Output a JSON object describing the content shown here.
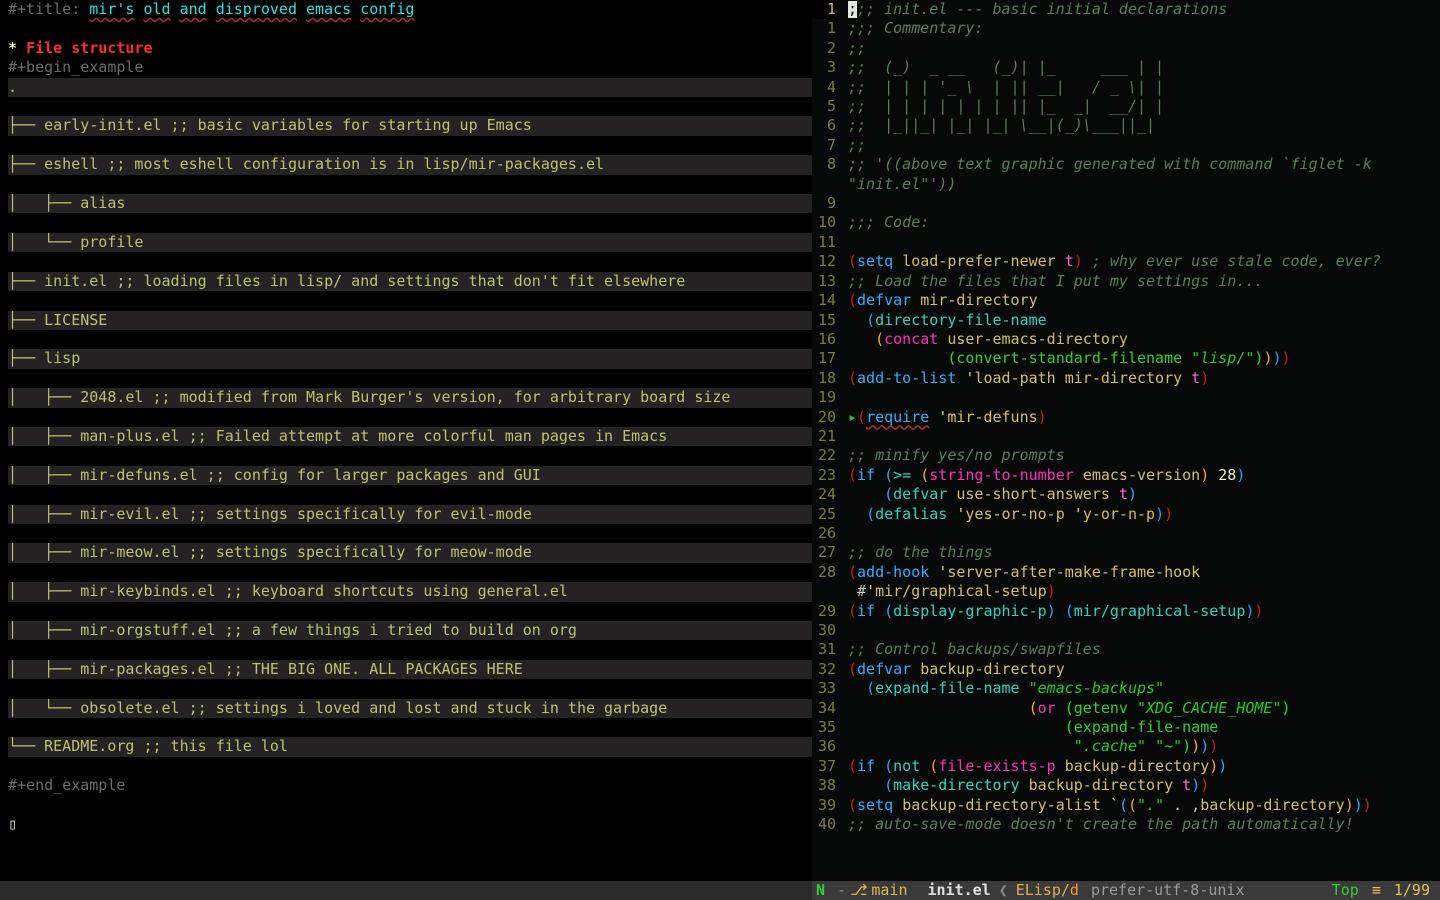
{
  "left": {
    "title_prefix": "#+title: ",
    "title_words": [
      "mir's",
      "old",
      "and",
      "disproved",
      "emacs",
      "config"
    ],
    "heading_star": "* ",
    "heading": "File structure",
    "begin": "#+begin_example",
    "end": "#+end_example",
    "tree": [
      ".",
      "├── early-init.el ;; basic variables for starting up Emacs",
      "├── eshell ;; most eshell configuration is in lisp/mir-packages.el",
      "│   ├── alias",
      "│   └── profile",
      "├── init.el ;; loading files in lisp/ and settings that don't fit elsewhere",
      "├── LICENSE",
      "├── lisp",
      "│   ├── 2048.el ;; modified from Mark Burger's version, for arbitrary board size",
      "│   ├── man-plus.el ;; Failed attempt at more colorful man pages in Emacs",
      "│   ├── mir-defuns.el ;; config for larger packages and GUI",
      "│   ├── mir-evil.el ;; settings specifically for evil-mode",
      "│   ├── mir-meow.el ;; settings specifically for meow-mode",
      "│   ├── mir-keybinds.el ;; keyboard shortcuts using general.el",
      "│   ├── mir-orgstuff.el ;; a few things i tried to build on org",
      "│   ├── mir-packages.el ;; THE BIG ONE. ALL PACKAGES HERE",
      "│   └── obsolete.el ;; settings i loved and lost and stuck in the garbage",
      "└── README.org ;; this file lol"
    ]
  },
  "right": {
    "current_line_badge": "1",
    "lines": [
      {
        "n": "",
        "raw": ";;; init.el --- basic initial declarations",
        "cls": "cmt"
      },
      {
        "n": "1",
        "raw": ";;; Commentary:",
        "cls": "cmt"
      },
      {
        "n": "2",
        "raw": ";;",
        "cls": "cmt"
      },
      {
        "n": "3",
        "raw": ";;  (_)  _ __   (_)| |_     ___ | |",
        "cls": "cmt"
      },
      {
        "n": "4",
        "raw": ";;  | | | '_ \\  | || __|   / _ \\| |",
        "cls": "cmt"
      },
      {
        "n": "5",
        "raw": ";;  | | | | | | | || |_  _|  __/| |",
        "cls": "cmt"
      },
      {
        "n": "6",
        "raw": ";;  |_||_| |_| |_| \\__|(_)\\___||_|",
        "cls": "cmt"
      },
      {
        "n": "7",
        "raw": ";;",
        "cls": "cmt"
      },
      {
        "n": "8",
        "raw": ";; '((above text graphic generated with command `figlet -k \"init.el\"'))",
        "cls": "cmt",
        "wrap": true
      },
      {
        "n": "9",
        "raw": "",
        "cls": ""
      },
      {
        "n": "10",
        "raw": ";;; Code:",
        "cls": "cmt"
      },
      {
        "n": "11",
        "raw": "",
        "cls": ""
      },
      {
        "n": "12",
        "tokens": [
          [
            "par",
            "("
          ],
          [
            "fn",
            "setq "
          ],
          [
            "var",
            "load-prefer-newer "
          ],
          [
            "sym",
            "t"
          ],
          [
            "par",
            ")"
          ],
          [
            "",
            " "
          ],
          [
            "cmt",
            "; why ever use stale code, ever?"
          ]
        ]
      },
      {
        "n": "13",
        "raw": ";; Load the files that I put my settings in...",
        "cls": "cmt"
      },
      {
        "n": "14",
        "tokens": [
          [
            "par",
            "("
          ],
          [
            "fn",
            "defvar "
          ],
          [
            "var",
            "mir-directory"
          ]
        ]
      },
      {
        "n": "15",
        "tokens": [
          [
            "",
            "  "
          ],
          [
            "par2",
            "("
          ],
          [
            "teal",
            "directory-file-name"
          ]
        ]
      },
      {
        "n": "16",
        "tokens": [
          [
            "",
            "   "
          ],
          [
            "par3",
            "("
          ],
          [
            "mag",
            "concat "
          ],
          [
            "var",
            "user-emacs-directory"
          ]
        ]
      },
      {
        "n": "17",
        "tokens": [
          [
            "",
            "           "
          ],
          [
            "par4",
            "("
          ],
          [
            "grn",
            "convert-standard-filename "
          ],
          [
            "str",
            "\"lisp/\""
          ],
          [
            "par4",
            ")"
          ],
          [
            "par3",
            ")"
          ],
          [
            "par2",
            ")"
          ],
          [
            "par",
            ")"
          ]
        ]
      },
      {
        "n": "18",
        "tokens": [
          [
            "par",
            "("
          ],
          [
            "fn",
            "add-to-list "
          ],
          [
            "ylw",
            "'"
          ],
          [
            "var",
            "load-path "
          ],
          [
            "var",
            "mir-directory "
          ],
          [
            "sym",
            "t"
          ],
          [
            "par",
            ")"
          ]
        ]
      },
      {
        "n": "19",
        "raw": "",
        "cls": ""
      },
      {
        "n": "20",
        "arrow": true,
        "tokens": [
          [
            "par",
            "("
          ],
          [
            "fn",
            "require"
          ],
          [
            "",
            " "
          ],
          [
            "ylw",
            "'"
          ],
          [
            "var",
            "mir-defuns"
          ],
          [
            "par",
            ")"
          ]
        ],
        "require_u": true
      },
      {
        "n": "21",
        "raw": "",
        "cls": ""
      },
      {
        "n": "22",
        "raw": ";; minify yes/no prompts",
        "cls": "cmt"
      },
      {
        "n": "23",
        "tokens": [
          [
            "par",
            "("
          ],
          [
            "fn",
            "if "
          ],
          [
            "par2",
            "("
          ],
          [
            "teal",
            ">= "
          ],
          [
            "par3",
            "("
          ],
          [
            "mag",
            "string-to-number "
          ],
          [
            "var",
            "emacs-version"
          ],
          [
            "par3",
            ")"
          ],
          [
            "",
            " "
          ],
          [
            "num",
            "28"
          ],
          [
            "par2",
            ")"
          ]
        ]
      },
      {
        "n": "24",
        "tokens": [
          [
            "",
            "    "
          ],
          [
            "par2",
            "("
          ],
          [
            "teal",
            "defvar "
          ],
          [
            "var",
            "use-short-answers "
          ],
          [
            "sym",
            "t"
          ],
          [
            "par2",
            ")"
          ]
        ]
      },
      {
        "n": "25",
        "tokens": [
          [
            "",
            "  "
          ],
          [
            "par2",
            "("
          ],
          [
            "teal",
            "defalias "
          ],
          [
            "ylw",
            "'"
          ],
          [
            "var",
            "yes-or-no-p "
          ],
          [
            "ylw",
            "'"
          ],
          [
            "var",
            "y-or-n-p"
          ],
          [
            "par2",
            ")"
          ],
          [
            "par",
            ")"
          ]
        ]
      },
      {
        "n": "26",
        "raw": "",
        "cls": ""
      },
      {
        "n": "27",
        "raw": ";; do the things",
        "cls": "cmt"
      },
      {
        "n": "28",
        "tokens": [
          [
            "par",
            "("
          ],
          [
            "fn",
            "add-hook "
          ],
          [
            "ylw",
            "'"
          ],
          [
            "var",
            "server-after-make-frame-hook"
          ]
        ]
      },
      {
        "n": "",
        "tokens": [
          [
            "",
            " #"
          ],
          [
            "ylw",
            "'"
          ],
          [
            "var",
            "mir/graphical-setup"
          ],
          [
            "par",
            ")"
          ]
        ]
      },
      {
        "n": "29",
        "tokens": [
          [
            "par",
            "("
          ],
          [
            "fn",
            "if "
          ],
          [
            "par2",
            "("
          ],
          [
            "teal",
            "display-graphic-p"
          ],
          [
            "par2",
            ")"
          ],
          [
            "",
            " "
          ],
          [
            "par2",
            "("
          ],
          [
            "teal",
            "mir/graphical-setup"
          ],
          [
            "par2",
            ")"
          ],
          [
            "par",
            ")"
          ]
        ]
      },
      {
        "n": "30",
        "raw": "",
        "cls": ""
      },
      {
        "n": "31",
        "raw": ";; Control backups/swapfiles",
        "cls": "cmt"
      },
      {
        "n": "32",
        "tokens": [
          [
            "par",
            "("
          ],
          [
            "fn",
            "defvar "
          ],
          [
            "var",
            "backup-directory"
          ]
        ]
      },
      {
        "n": "33",
        "tokens": [
          [
            "",
            "  "
          ],
          [
            "par2",
            "("
          ],
          [
            "teal",
            "expand-file-name "
          ],
          [
            "str",
            "\"emacs-backups\""
          ]
        ]
      },
      {
        "n": "34",
        "tokens": [
          [
            "",
            "                    "
          ],
          [
            "par3",
            "("
          ],
          [
            "mag",
            "or "
          ],
          [
            "par4",
            "("
          ],
          [
            "grn",
            "getenv "
          ],
          [
            "str",
            "\"XDG_CACHE_HOME\""
          ],
          [
            "par4",
            ")"
          ]
        ]
      },
      {
        "n": "35",
        "tokens": [
          [
            "",
            "                        "
          ],
          [
            "par4",
            "("
          ],
          [
            "grn",
            "expand-file-name"
          ]
        ]
      },
      {
        "n": "36",
        "tokens": [
          [
            "",
            "                         "
          ],
          [
            "str",
            "\".cache\" "
          ],
          [
            "str",
            "\"~\""
          ],
          [
            "par4",
            ")"
          ],
          [
            "par3",
            ")"
          ],
          [
            "par2",
            ")"
          ],
          [
            "par",
            ")"
          ]
        ]
      },
      {
        "n": "37",
        "tokens": [
          [
            "par",
            "("
          ],
          [
            "fn",
            "if "
          ],
          [
            "par2",
            "("
          ],
          [
            "teal",
            "not "
          ],
          [
            "par3",
            "("
          ],
          [
            "mag",
            "file-exists-p "
          ],
          [
            "var",
            "backup-directory"
          ],
          [
            "par3",
            ")"
          ],
          [
            "par2",
            ")"
          ]
        ]
      },
      {
        "n": "38",
        "tokens": [
          [
            "",
            "    "
          ],
          [
            "par2",
            "("
          ],
          [
            "teal",
            "make-directory "
          ],
          [
            "var",
            "backup-directory "
          ],
          [
            "sym",
            "t"
          ],
          [
            "par2",
            ")"
          ],
          [
            "par",
            ")"
          ]
        ]
      },
      {
        "n": "39",
        "tokens": [
          [
            "par",
            "("
          ],
          [
            "fn",
            "setq "
          ],
          [
            "var",
            "backup-directory-alist "
          ],
          [
            "ylw",
            "`"
          ],
          [
            "par2",
            "("
          ],
          [
            "par3",
            "("
          ],
          [
            "str",
            "\".\""
          ],
          [
            "",
            " . ,"
          ],
          [
            "var",
            "backup-directory"
          ],
          [
            "par3",
            ")"
          ],
          [
            "par2",
            ")"
          ],
          [
            "par",
            ")"
          ]
        ]
      },
      {
        "n": "40",
        "raw": ";; auto-save-mode doesn't create the path automatically!",
        "cls": "cmt"
      }
    ]
  },
  "status": {
    "N": "N",
    "dash": "-",
    "branch_icon": "⎇",
    "branch": "main",
    "file": "init.el",
    "langle": "❮",
    "mode1": "ELisp/",
    "mode2": "d",
    "encoding": "prefer-utf-8-unix",
    "pos_top": "Top",
    "pos_eq": "≡",
    "pos_loc": "1/99"
  }
}
